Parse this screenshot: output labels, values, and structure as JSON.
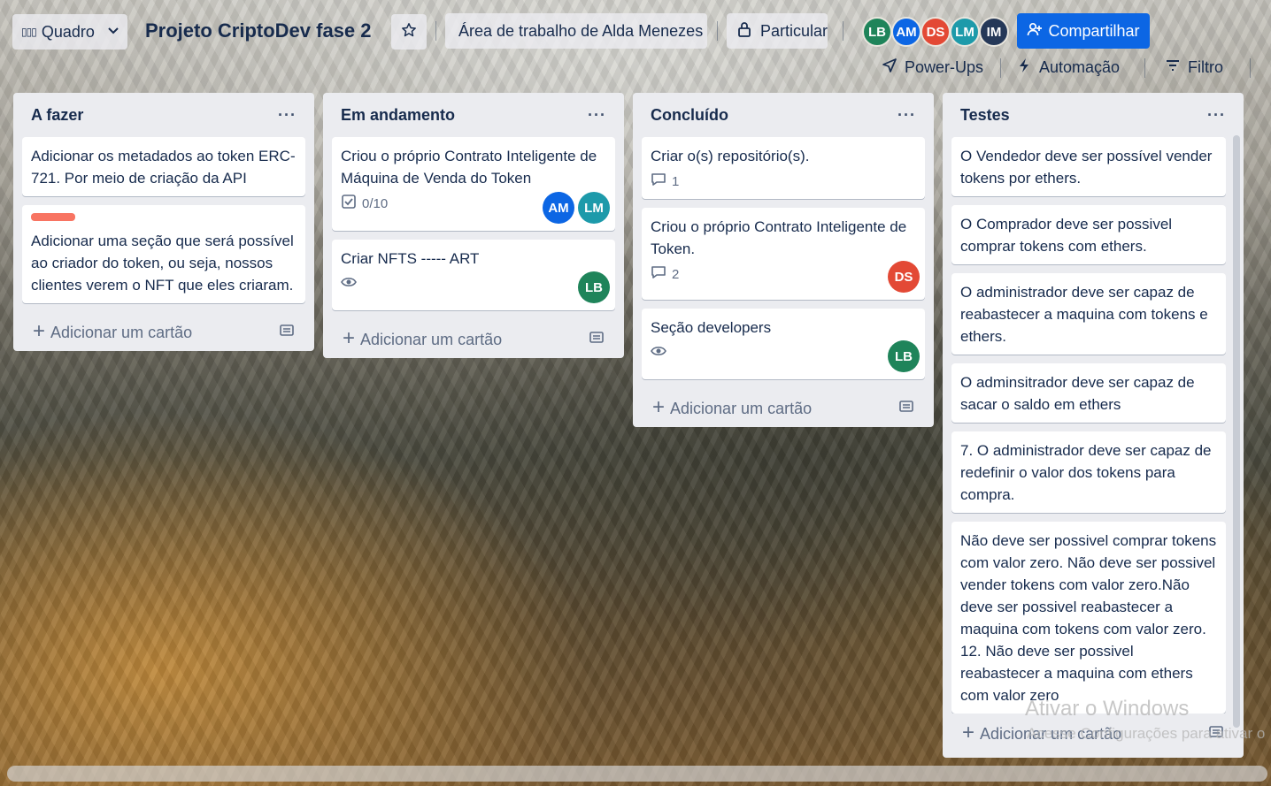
{
  "header": {
    "view_label": "Quadro",
    "board_title": "Projeto CriptoDev fase 2",
    "workspace_label": "Área de trabalho de Alda Menezes",
    "visibility_label": "Particular",
    "share_label": "Compartilhar",
    "members": [
      {
        "initials": "LB",
        "color": "#1f845a"
      },
      {
        "initials": "AM",
        "color": "#0c66e4"
      },
      {
        "initials": "DS",
        "color": "#e34935"
      },
      {
        "initials": "LM",
        "color": "#1d9aaa"
      },
      {
        "initials": "IM",
        "color": "#253858"
      }
    ],
    "tools": {
      "powerups": "Power-Ups",
      "automation": "Automação",
      "filter": "Filtro"
    }
  },
  "lists": [
    {
      "title": "A fazer",
      "add_label": "Adicionar um cartão",
      "cards": [
        {
          "text": "Adicionar os metadados ao token ERC-721. Por meio de criação da API"
        },
        {
          "text": "Adicionar uma seção que será possível ao criador do token, ou seja, nossos clientes verem o NFT que eles criaram.",
          "label_color": "#f87462"
        }
      ]
    },
    {
      "title": "Em andamento",
      "add_label": "Adicionar um cartão",
      "cards": [
        {
          "text": "Criou o próprio Contrato Inteligente de Máquina de Venda do Token",
          "checklist": "0/10",
          "members": [
            "AM",
            "LM"
          ]
        },
        {
          "text": "Criar NFTS ----- ART",
          "members": [
            "LB"
          ]
        }
      ]
    },
    {
      "title": "Concluído",
      "add_label": "Adicionar um cartão",
      "cards": [
        {
          "text": "Criar o(s) repositório(s).",
          "comments": "1"
        },
        {
          "text": "Criou o próprio Contrato Inteligente de Token.",
          "comments": "2",
          "members": [
            "DS"
          ]
        },
        {
          "text": "Seção developers",
          "members": [
            "LB"
          ]
        }
      ]
    },
    {
      "title": "Testes",
      "add_label": "Adicionar um cartão",
      "cards": [
        {
          "text": "O Vendedor deve ser possível vender tokens por ethers."
        },
        {
          "text": "O Comprador deve ser possivel comprar tokens com ethers."
        },
        {
          "text": "O administrador deve ser capaz de reabastecer a maquina com tokens e ethers."
        },
        {
          "text": "O adminsitrador deve ser capaz de sacar o saldo em ethers"
        },
        {
          "text": "7. O administrador deve ser capaz de redefinir o valor dos tokens para compra."
        },
        {
          "text": "Não deve ser possivel comprar tokens com valor zero. Não deve ser possivel vender tokens com valor zero.Não deve ser possivel reabastecer a maquina com tokens com valor zero. 12. Não deve ser possivel reabastecer a maquina com ethers com valor zero"
        }
      ]
    }
  ],
  "watermark": {
    "line1": "Ativar o Windows",
    "line2": "Acesse Configurações para ativar o"
  }
}
